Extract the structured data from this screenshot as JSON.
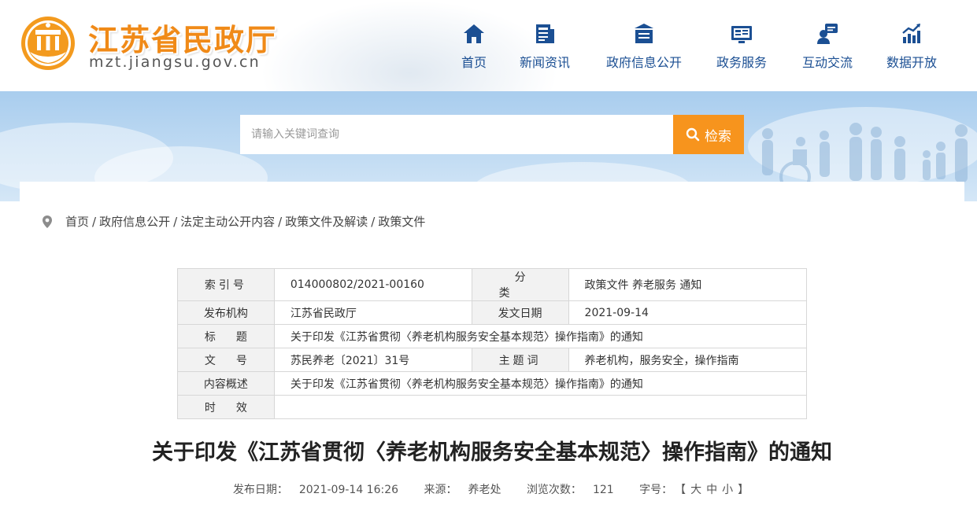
{
  "header": {
    "site_title": "江苏省民政厅",
    "site_domain": "mzt.jiangsu.gov.cn",
    "brand_orange": "#f08a18",
    "nav_color": "#1b4f93",
    "nav": [
      {
        "label": "首页",
        "icon": "home-icon"
      },
      {
        "label": "新闻资讯",
        "icon": "news-icon"
      },
      {
        "label": "政府信息公开",
        "icon": "disclosure-icon"
      },
      {
        "label": "政务服务",
        "icon": "service-icon"
      },
      {
        "label": "互动交流",
        "icon": "interaction-icon"
      },
      {
        "label": "数据开放",
        "icon": "data-chart-icon"
      }
    ]
  },
  "search": {
    "placeholder": "请输入关键词查询",
    "button_label": "检索",
    "button_color": "#f7941d"
  },
  "breadcrumb": [
    "首页",
    "政府信息公开",
    "法定主动公开内容",
    "政策文件及解读",
    "政策文件"
  ],
  "info_table": {
    "index_no_label": "索引号",
    "index_no": "014000802/2021-00160",
    "category_label": "分类",
    "category": "政策文件 养老服务 通知",
    "issuer_label": "发布机构",
    "issuer": "江苏省民政厅",
    "issue_date_label": "发文日期",
    "issue_date": "2021-09-14",
    "title_label": "标题",
    "title": "关于印发《江苏省贯彻〈养老机构服务安全基本规范〉操作指南》的通知",
    "doc_no_label": "文号",
    "doc_no": "苏民养老〔2021〕31号",
    "keywords_label": "主题词",
    "keywords": "养老机构，服务安全，操作指南",
    "summary_label": "内容概述",
    "summary": "关于印发《江苏省贯彻〈养老机构服务安全基本规范〉操作指南》的通知",
    "validity_label": "时效",
    "validity": ""
  },
  "article": {
    "title": "关于印发《江苏省贯彻〈养老机构服务安全基本规范〉操作指南》的通知",
    "publish_label": "发布日期：",
    "publish_time": "2021-09-14 16:26",
    "source_label": "来源：",
    "source": "养老处",
    "views_label": "浏览次数：",
    "views": "121",
    "font_label": "字号：",
    "font_open": "【",
    "font_large": "大",
    "font_medium": "中",
    "font_small": "小",
    "font_close": "】"
  }
}
